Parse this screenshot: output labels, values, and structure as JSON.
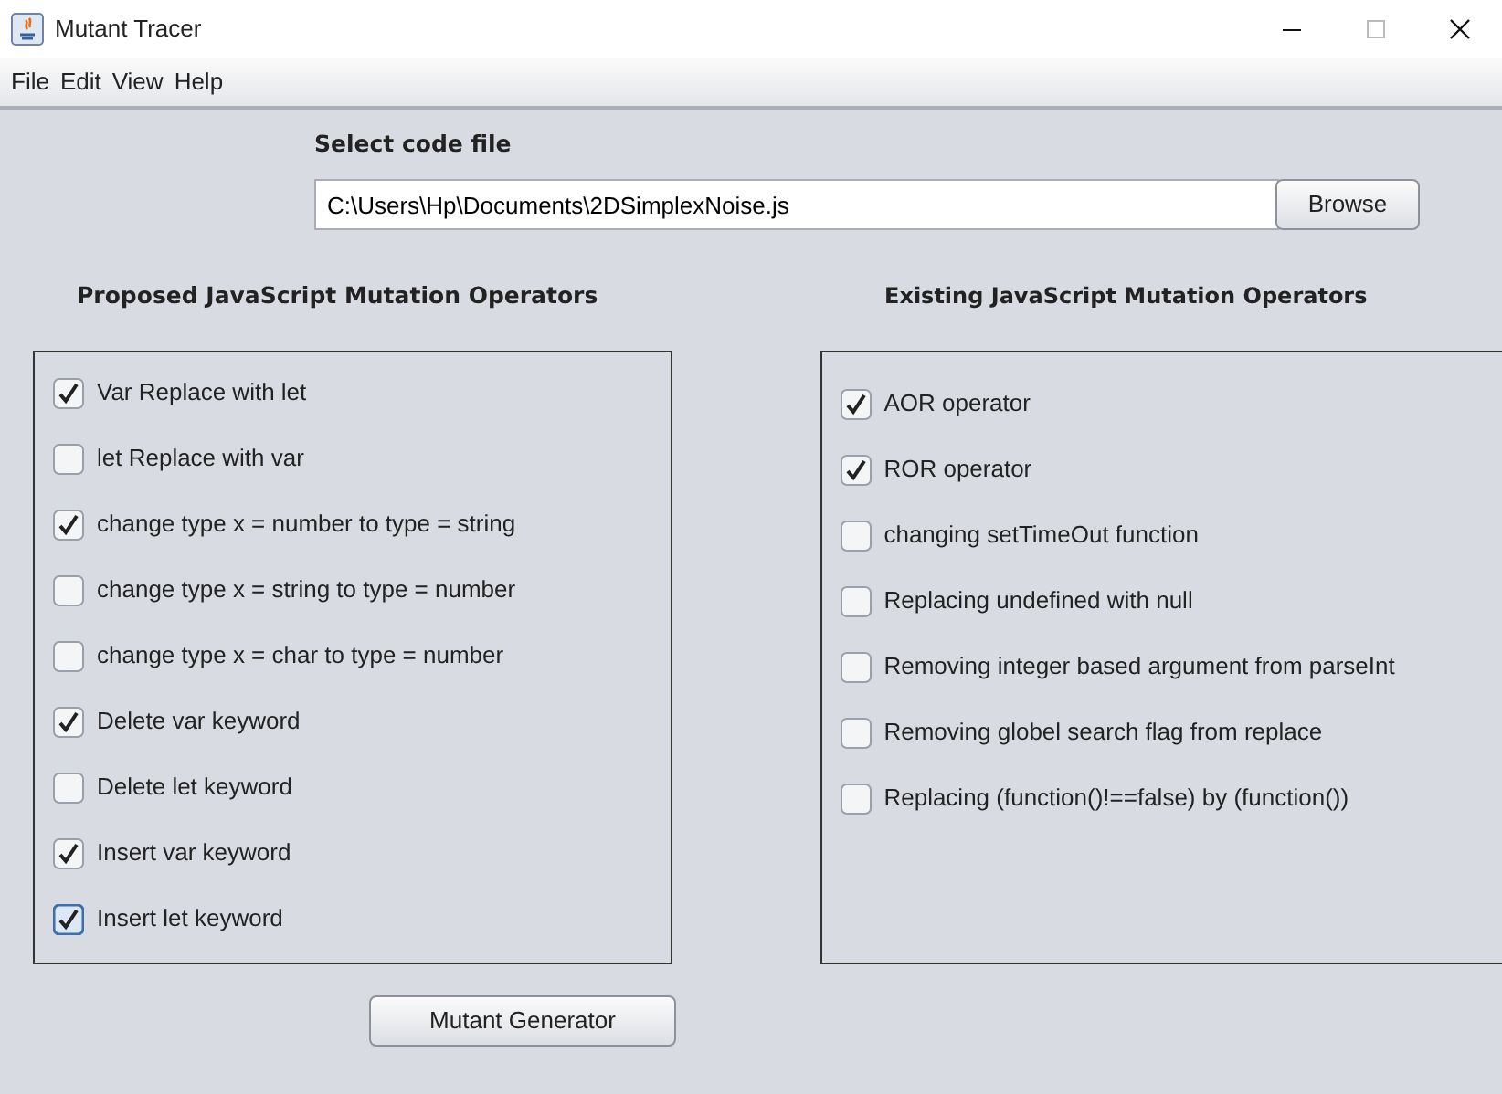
{
  "window": {
    "title": "Mutant Tracer"
  },
  "menu": [
    "File",
    "Edit",
    "View",
    "Help"
  ],
  "file_select": {
    "label": "Select code file",
    "value": "C:\\Users\\Hp\\Documents\\2DSimplexNoise.js",
    "button": "Browse"
  },
  "proposed": {
    "heading": "Proposed JavaScript Mutation Operators",
    "items": [
      {
        "label": "Var Replace with let",
        "checked": true,
        "focused": false
      },
      {
        "label": "let Replace with var",
        "checked": false,
        "focused": false
      },
      {
        "label": "change type x = number to type = string",
        "checked": true,
        "focused": false
      },
      {
        "label": "change type x = string to type = number",
        "checked": false,
        "focused": false
      },
      {
        "label": "change type x = char to type = number",
        "checked": false,
        "focused": false
      },
      {
        "label": "Delete var keyword",
        "checked": true,
        "focused": false
      },
      {
        "label": "Delete let keyword",
        "checked": false,
        "focused": false
      },
      {
        "label": "Insert var keyword",
        "checked": true,
        "focused": false
      },
      {
        "label": "Insert let keyword",
        "checked": true,
        "focused": true
      }
    ]
  },
  "existing": {
    "heading": "Existing JavaScript Mutation Operators",
    "items": [
      {
        "label": "AOR operator",
        "checked": true
      },
      {
        "label": "ROR operator",
        "checked": true
      },
      {
        "label": "changing setTimeOut function",
        "checked": false
      },
      {
        "label": "Replacing undefined with null",
        "checked": false
      },
      {
        "label": "Removing integer based argument from parseInt",
        "checked": false
      },
      {
        "label": "Removing globel search flag from replace",
        "checked": false
      },
      {
        "label": "Replacing (function()!==false) by (function())",
        "checked": false
      }
    ]
  },
  "generate_button": "Mutant Generator"
}
